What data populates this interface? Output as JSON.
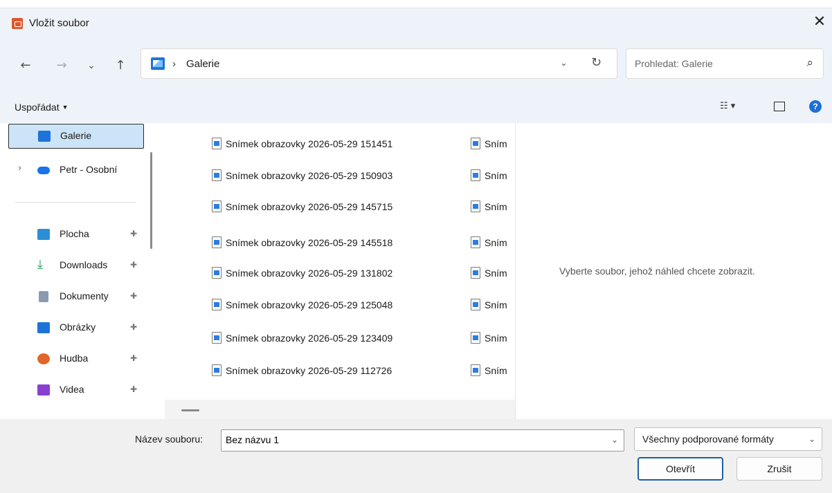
{
  "window": {
    "title": "Vložit soubor",
    "close_glyph": "✕"
  },
  "nav": {
    "back_glyph": "←",
    "forward_glyph": "→",
    "recent_glyph": "⌄",
    "up_glyph": "↑",
    "address": {
      "separator": "›",
      "location": "Galerie",
      "dropdown_glyph": "⌄",
      "refresh_glyph": "↻"
    },
    "search": {
      "placeholder": "Prohledat: Galerie",
      "icon_glyph": "⌕"
    }
  },
  "command_bar": {
    "organize_label": "Uspořádat",
    "organize_caret": "▼",
    "view_glyph": "☷ ▾",
    "help_glyph": "?"
  },
  "sidebar": {
    "items": [
      {
        "label": "Galerie",
        "icon": "gallery-icon",
        "color": "#1e73d8",
        "selected": true,
        "pinned": false
      },
      {
        "label": "Petr - Osobní",
        "icon": "onedrive-cloud-icon",
        "color": "#1a73e8",
        "selected": false,
        "pinned": false,
        "expandable": true
      },
      {
        "label": "Plocha",
        "icon": "desktop-icon",
        "color": "#2a8fd6",
        "pinned": true
      },
      {
        "label": "Downloads",
        "icon": "download-arrow-icon",
        "color": "#1f9d55",
        "pinned": true
      },
      {
        "label": "Dokumenty",
        "icon": "document-icon",
        "color": "#8a9bb0",
        "pinned": true
      },
      {
        "label": "Obrázky",
        "icon": "pictures-icon",
        "color": "#1e73d8",
        "pinned": true
      },
      {
        "label": "Hudba",
        "icon": "music-icon",
        "color": "#e0662a",
        "pinned": true
      },
      {
        "label": "Videa",
        "icon": "video-icon",
        "color": "#8a3fd1",
        "pinned": true
      }
    ],
    "pin_glyph": "📌",
    "expand_glyph": "›"
  },
  "files": [
    {
      "name": "Snímek obrazovky 2026-05-29 151451",
      "col2": "Sním"
    },
    {
      "name": "Snímek obrazovky 2026-05-29 150903",
      "col2": "Sním"
    },
    {
      "name": "Snímek obrazovky 2026-05-29 145715",
      "col2": "Sním"
    },
    {
      "name": "Snímek obrazovky 2026-05-29 145518",
      "col2": "Sním"
    },
    {
      "name": "Snímek obrazovky 2026-05-29 131802",
      "col2": "Sním"
    },
    {
      "name": "Snímek obrazovky 2026-05-29 125048",
      "col2": "Sním"
    },
    {
      "name": "Snímek obrazovky 2026-05-29 123409",
      "col2": "Sním"
    },
    {
      "name": "Snímek obrazovky 2026-05-29 112726",
      "col2": "Sním"
    }
  ],
  "preview": {
    "message": "Vyberte soubor, jehož náhled chcete zobrazit."
  },
  "footer": {
    "filename_label": "Název souboru:",
    "filename_value": "Bez názvu 1",
    "file_type": "Všechny podporované formáty",
    "open_label": "Otevřít",
    "cancel_label": "Zrušit",
    "caret_glyph": "⌄"
  }
}
